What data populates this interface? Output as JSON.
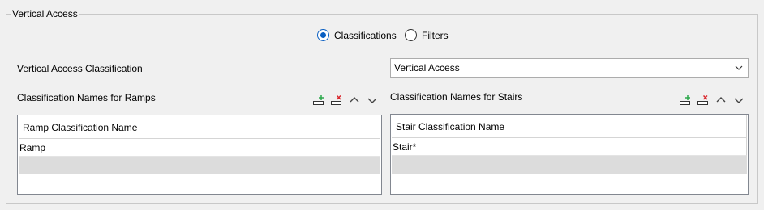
{
  "group": {
    "title": "Vertical Access"
  },
  "mode": {
    "options": [
      {
        "label": "Classifications",
        "checked": true
      },
      {
        "label": "Filters",
        "checked": false
      }
    ]
  },
  "classification": {
    "label": "Vertical Access Classification",
    "selected": "Vertical Access"
  },
  "ramps": {
    "title": "Classification Names for Ramps",
    "column": "Ramp Classification Name",
    "rows": [
      "Ramp"
    ]
  },
  "stairs": {
    "title": "Classification Names for Stairs",
    "column": "Stair Classification Name",
    "rows": [
      "Stair*"
    ]
  },
  "toolbar_icons": [
    "add-row-icon",
    "delete-row-icon",
    "move-up-icon",
    "move-down-icon"
  ],
  "colors": {
    "accent": "#0a5fc2",
    "add": "#2aa84a",
    "delete": "#d9252b"
  }
}
